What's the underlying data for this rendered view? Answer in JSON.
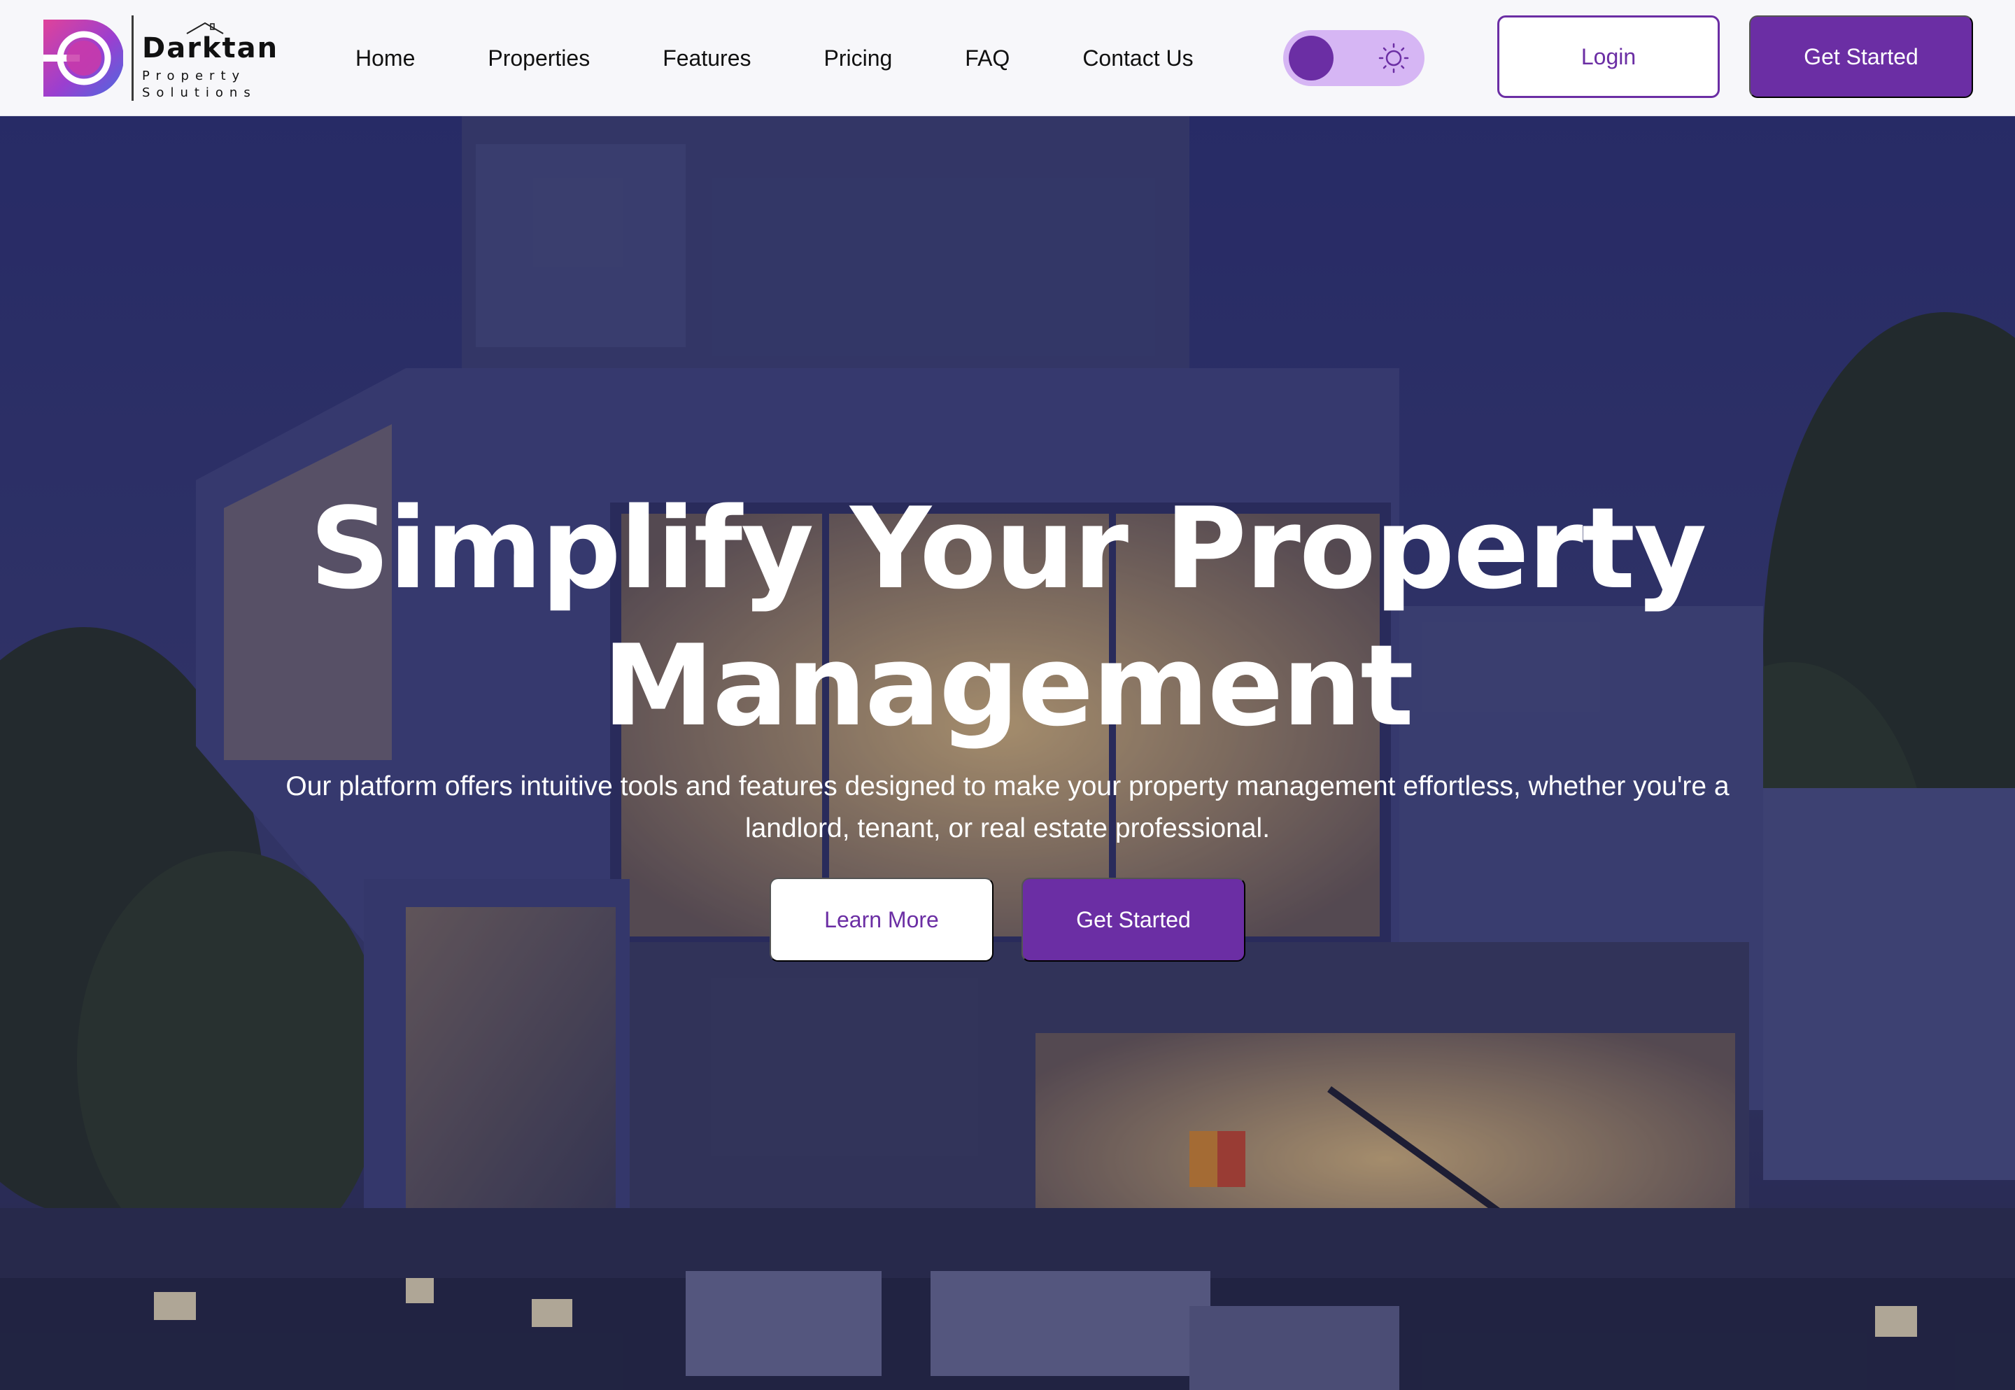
{
  "brand": {
    "name": "Darktan",
    "sub_line1": "Property",
    "sub_line2": "Solutions",
    "logo_colors": [
      "#e0429a",
      "#8b3fd1",
      "#4a6be0"
    ]
  },
  "nav": {
    "links": [
      {
        "label": "Home"
      },
      {
        "label": "Properties"
      },
      {
        "label": "Features"
      },
      {
        "label": "Pricing"
      },
      {
        "label": "FAQ"
      },
      {
        "label": "Contact Us"
      }
    ],
    "theme_toggle": {
      "icon": "sun-icon",
      "state": "dark-knob-left"
    },
    "login_label": "Login",
    "get_started_label": "Get Started"
  },
  "hero": {
    "title_line1": "Simplify Your Property",
    "title_line2": "Management",
    "subtitle": "Our platform offers intuitive tools and features designed to make your property management effortless, whether you're a landlord, tenant, or real estate professional.",
    "learn_more_label": "Learn More",
    "get_started_label": "Get Started",
    "background": "modern-house-at-dusk-photo"
  },
  "colors": {
    "accent": "#6b2ea4",
    "toggle_track": "#d6b6f4",
    "nav_bg": "#f7f7fa",
    "hero_overlay": "#1c1e4e"
  }
}
